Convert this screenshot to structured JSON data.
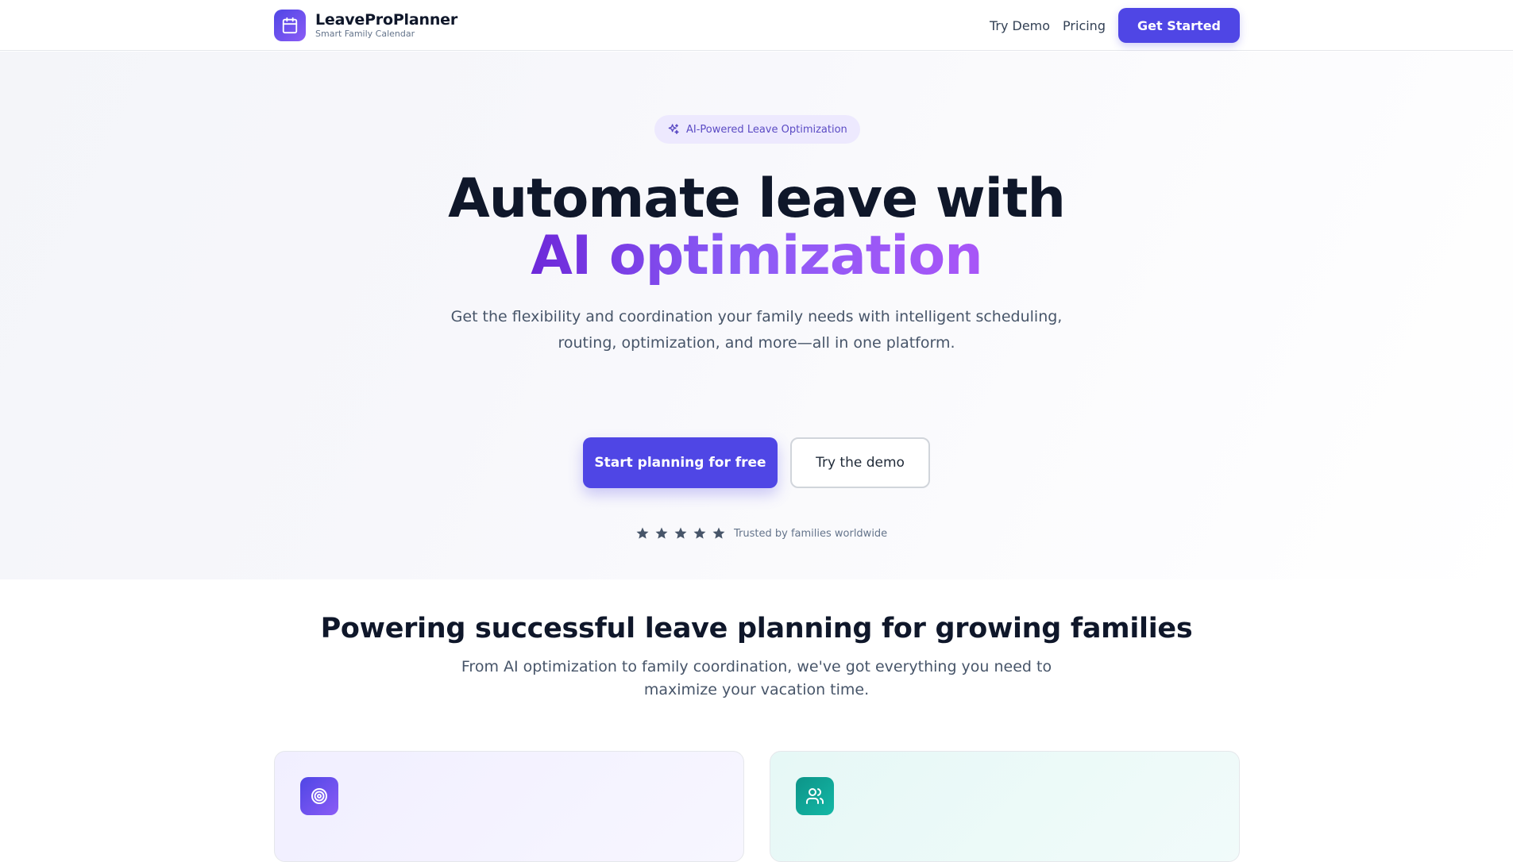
{
  "brand": {
    "name": "LeaveProPlanner",
    "tagline": "Smart Family Calendar"
  },
  "nav": {
    "links": [
      "Try Demo",
      "Pricing"
    ],
    "cta": "Get Started"
  },
  "hero": {
    "badge": "AI-Powered Leave Optimization",
    "title_line1": "Automate leave with",
    "title_line2": "AI optimization",
    "subtitle_line1": "Get the flexibility and coordination your family needs with intelligent scheduling,",
    "subtitle_line2": "routing, optimization, and more—all in one platform.",
    "primary_button": "Start planning for free",
    "secondary_button": "Try the demo",
    "rating_stars": 5,
    "trust_text": "Trusted by families worldwide"
  },
  "features": {
    "title": "Powering successful leave planning for growing families",
    "subtitle_line1": "From AI optimization to family coordination, we've got everything you need to",
    "subtitle_line2": "maximize your vacation time.",
    "cards": [
      {
        "icon": "target-icon"
      },
      {
        "icon": "users-icon"
      }
    ]
  },
  "colors": {
    "primary": "#4f46e5",
    "accent_purple": "#8b5cf6",
    "teal": "#14b8a6",
    "text_dark": "#0f172a",
    "text_muted": "#475569"
  }
}
